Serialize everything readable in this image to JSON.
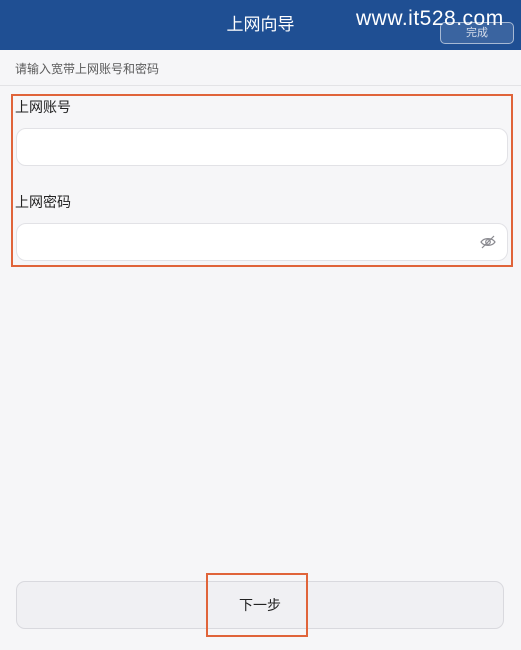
{
  "header": {
    "title": "上网向导",
    "button_label": "完成",
    "background_color": "#1f4f93"
  },
  "watermark": {
    "text": "www.it528.com"
  },
  "hint": {
    "text": "请输入宽带上网账号和密码"
  },
  "form": {
    "account": {
      "label": "上网账号",
      "value": "",
      "placeholder": ""
    },
    "password": {
      "label": "上网密码",
      "value": "",
      "placeholder": "",
      "toggle_icon": "eye-closed-icon"
    }
  },
  "footer": {
    "next_label": "下一步"
  },
  "colors": {
    "highlight": "#e0643a",
    "page_background": "#f6f6f8"
  }
}
